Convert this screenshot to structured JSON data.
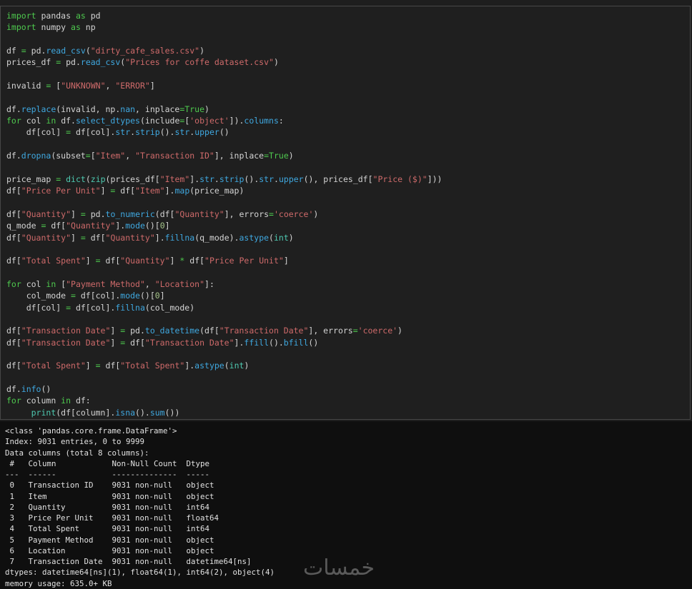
{
  "code_cell": {
    "lines": [
      [
        [
          "k",
          "import"
        ],
        [
          "p",
          " pandas "
        ],
        [
          "k",
          "as"
        ],
        [
          "p",
          " pd"
        ]
      ],
      [
        [
          "k",
          "import"
        ],
        [
          "p",
          " numpy "
        ],
        [
          "k",
          "as"
        ],
        [
          "p",
          " np"
        ]
      ],
      [],
      [
        [
          "p",
          "df "
        ],
        [
          "k",
          "="
        ],
        [
          "p",
          " pd."
        ],
        [
          "f",
          "read_csv"
        ],
        [
          "p",
          "("
        ],
        [
          "s",
          "\"dirty_cafe_sales.csv\""
        ],
        [
          "p",
          ")"
        ]
      ],
      [
        [
          "p",
          "prices_df "
        ],
        [
          "k",
          "="
        ],
        [
          "p",
          " pd."
        ],
        [
          "f",
          "read_csv"
        ],
        [
          "p",
          "("
        ],
        [
          "s",
          "\"Prices for coffe dataset.csv\""
        ],
        [
          "p",
          ")"
        ]
      ],
      [],
      [
        [
          "p",
          "invalid "
        ],
        [
          "k",
          "="
        ],
        [
          "p",
          " ["
        ],
        [
          "s",
          "\"UNKNOWN\""
        ],
        [
          "p",
          ", "
        ],
        [
          "s",
          "\"ERROR\""
        ],
        [
          "p",
          "]"
        ]
      ],
      [],
      [
        [
          "p",
          "df."
        ],
        [
          "f",
          "replace"
        ],
        [
          "p",
          "(invalid, np."
        ],
        [
          "f",
          "nan"
        ],
        [
          "p",
          ", inplace"
        ],
        [
          "k",
          "="
        ],
        [
          "k",
          "True"
        ],
        [
          "p",
          ")"
        ]
      ],
      [
        [
          "k",
          "for"
        ],
        [
          "p",
          " col "
        ],
        [
          "k",
          "in"
        ],
        [
          "p",
          " df."
        ],
        [
          "f",
          "select_dtypes"
        ],
        [
          "p",
          "(include"
        ],
        [
          "k",
          "="
        ],
        [
          "p",
          "["
        ],
        [
          "s",
          "'object'"
        ],
        [
          "p",
          "])."
        ],
        [
          "f",
          "columns"
        ],
        [
          "p",
          ":"
        ]
      ],
      [
        [
          "p",
          "    df[col] "
        ],
        [
          "k",
          "="
        ],
        [
          "p",
          " df[col]."
        ],
        [
          "f",
          "str"
        ],
        [
          "p",
          "."
        ],
        [
          "f",
          "strip"
        ],
        [
          "p",
          "()."
        ],
        [
          "f",
          "str"
        ],
        [
          "p",
          "."
        ],
        [
          "f",
          "upper"
        ],
        [
          "p",
          "()"
        ]
      ],
      [],
      [
        [
          "p",
          "df."
        ],
        [
          "f",
          "dropna"
        ],
        [
          "p",
          "(subset"
        ],
        [
          "k",
          "="
        ],
        [
          "p",
          "["
        ],
        [
          "s",
          "\"Item\""
        ],
        [
          "p",
          ", "
        ],
        [
          "s",
          "\"Transaction ID\""
        ],
        [
          "p",
          "], inplace"
        ],
        [
          "k",
          "="
        ],
        [
          "k",
          "True"
        ],
        [
          "p",
          ")"
        ]
      ],
      [],
      [
        [
          "p",
          "price_map "
        ],
        [
          "k",
          "="
        ],
        [
          "p",
          " "
        ],
        [
          "c",
          "dict"
        ],
        [
          "p",
          "("
        ],
        [
          "c",
          "zip"
        ],
        [
          "p",
          "(prices_df["
        ],
        [
          "s",
          "\"Item\""
        ],
        [
          "p",
          "]."
        ],
        [
          "f",
          "str"
        ],
        [
          "p",
          "."
        ],
        [
          "f",
          "strip"
        ],
        [
          "p",
          "()."
        ],
        [
          "f",
          "str"
        ],
        [
          "p",
          "."
        ],
        [
          "f",
          "upper"
        ],
        [
          "p",
          "(), prices_df["
        ],
        [
          "s",
          "\"Price ($)\""
        ],
        [
          "p",
          "]))"
        ]
      ],
      [
        [
          "p",
          "df["
        ],
        [
          "s",
          "\"Price Per Unit\""
        ],
        [
          "p",
          "] "
        ],
        [
          "k",
          "="
        ],
        [
          "p",
          " df["
        ],
        [
          "s",
          "\"Item\""
        ],
        [
          "p",
          "]."
        ],
        [
          "f",
          "map"
        ],
        [
          "p",
          "(price_map)"
        ]
      ],
      [],
      [
        [
          "p",
          "df["
        ],
        [
          "s",
          "\"Quantity\""
        ],
        [
          "p",
          "] "
        ],
        [
          "k",
          "="
        ],
        [
          "p",
          " pd."
        ],
        [
          "f",
          "to_numeric"
        ],
        [
          "p",
          "(df["
        ],
        [
          "s",
          "\"Quantity\""
        ],
        [
          "p",
          "], errors"
        ],
        [
          "k",
          "="
        ],
        [
          "s",
          "'coerce'"
        ],
        [
          "p",
          ")"
        ]
      ],
      [
        [
          "p",
          "q_mode "
        ],
        [
          "k",
          "="
        ],
        [
          "p",
          " df["
        ],
        [
          "s",
          "\"Quantity\""
        ],
        [
          "p",
          "]."
        ],
        [
          "f",
          "mode"
        ],
        [
          "p",
          "()["
        ],
        [
          "n",
          "0"
        ],
        [
          "p",
          "]"
        ]
      ],
      [
        [
          "p",
          "df["
        ],
        [
          "s",
          "\"Quantity\""
        ],
        [
          "p",
          "] "
        ],
        [
          "k",
          "="
        ],
        [
          "p",
          " df["
        ],
        [
          "s",
          "\"Quantity\""
        ],
        [
          "p",
          "]."
        ],
        [
          "f",
          "fillna"
        ],
        [
          "p",
          "(q_mode)."
        ],
        [
          "f",
          "astype"
        ],
        [
          "p",
          "("
        ],
        [
          "c",
          "int"
        ],
        [
          "p",
          ")"
        ]
      ],
      [],
      [
        [
          "p",
          "df["
        ],
        [
          "s",
          "\"Total Spent\""
        ],
        [
          "p",
          "] "
        ],
        [
          "k",
          "="
        ],
        [
          "p",
          " df["
        ],
        [
          "s",
          "\"Quantity\""
        ],
        [
          "p",
          "] "
        ],
        [
          "k",
          "*"
        ],
        [
          "p",
          " df["
        ],
        [
          "s",
          "\"Price Per Unit\""
        ],
        [
          "p",
          "]"
        ]
      ],
      [],
      [
        [
          "k",
          "for"
        ],
        [
          "p",
          " col "
        ],
        [
          "k",
          "in"
        ],
        [
          "p",
          " ["
        ],
        [
          "s",
          "\"Payment Method\""
        ],
        [
          "p",
          ", "
        ],
        [
          "s",
          "\"Location\""
        ],
        [
          "p",
          "]:"
        ]
      ],
      [
        [
          "p",
          "    col_mode "
        ],
        [
          "k",
          "="
        ],
        [
          "p",
          " df[col]."
        ],
        [
          "f",
          "mode"
        ],
        [
          "p",
          "()["
        ],
        [
          "n",
          "0"
        ],
        [
          "p",
          "]"
        ]
      ],
      [
        [
          "p",
          "    df[col] "
        ],
        [
          "k",
          "="
        ],
        [
          "p",
          " df[col]."
        ],
        [
          "f",
          "fillna"
        ],
        [
          "p",
          "(col_mode)"
        ]
      ],
      [],
      [
        [
          "p",
          "df["
        ],
        [
          "s",
          "\"Transaction Date\""
        ],
        [
          "p",
          "] "
        ],
        [
          "k",
          "="
        ],
        [
          "p",
          " pd."
        ],
        [
          "f",
          "to_datetime"
        ],
        [
          "p",
          "(df["
        ],
        [
          "s",
          "\"Transaction Date\""
        ],
        [
          "p",
          "], errors"
        ],
        [
          "k",
          "="
        ],
        [
          "s",
          "'coerce'"
        ],
        [
          "p",
          ")"
        ]
      ],
      [
        [
          "p",
          "df["
        ],
        [
          "s",
          "\"Transaction Date\""
        ],
        [
          "p",
          "] "
        ],
        [
          "k",
          "="
        ],
        [
          "p",
          " df["
        ],
        [
          "s",
          "\"Transaction Date\""
        ],
        [
          "p",
          "]."
        ],
        [
          "f",
          "ffill"
        ],
        [
          "p",
          "()."
        ],
        [
          "f",
          "bfill"
        ],
        [
          "p",
          "()"
        ]
      ],
      [],
      [
        [
          "p",
          "df["
        ],
        [
          "s",
          "\"Total Spent\""
        ],
        [
          "p",
          "] "
        ],
        [
          "k",
          "="
        ],
        [
          "p",
          " df["
        ],
        [
          "s",
          "\"Total Spent\""
        ],
        [
          "p",
          "]."
        ],
        [
          "f",
          "astype"
        ],
        [
          "p",
          "("
        ],
        [
          "c",
          "int"
        ],
        [
          "p",
          ")"
        ]
      ],
      [],
      [
        [
          "p",
          "df."
        ],
        [
          "f",
          "info"
        ],
        [
          "p",
          "()"
        ]
      ],
      [
        [
          "k",
          "for"
        ],
        [
          "p",
          " column "
        ],
        [
          "k",
          "in"
        ],
        [
          "p",
          " df:"
        ]
      ],
      [
        [
          "p",
          "     "
        ],
        [
          "c",
          "print"
        ],
        [
          "p",
          "(df[column]."
        ],
        [
          "f",
          "isna"
        ],
        [
          "p",
          "()."
        ],
        [
          "f",
          "sum"
        ],
        [
          "p",
          "())"
        ]
      ]
    ]
  },
  "output_cell": {
    "lines": [
      "<class 'pandas.core.frame.DataFrame'>",
      "Index: 9031 entries, 0 to 9999",
      "Data columns (total 8 columns):",
      " #   Column            Non-Null Count  Dtype",
      "---  ------            --------------  -----",
      " 0   Transaction ID    9031 non-null   object",
      " 1   Item              9031 non-null   object",
      " 2   Quantity          9031 non-null   int64",
      " 3   Price Per Unit    9031 non-null   float64",
      " 4   Total Spent       9031 non-null   int64",
      " 5   Payment Method    9031 non-null   object",
      " 6   Location          9031 non-null   object",
      " 7   Transaction Date  9031 non-null   datetime64[ns]",
      "dtypes: datetime64[ns](1), float64(1), int64(2), object(4)",
      "memory usage: 635.0+ KB"
    ]
  },
  "watermark": {
    "text": "خمسات"
  },
  "colors": {
    "keyword": "#4ec94e",
    "string": "#ce6a6a",
    "function": "#3fa8e0",
    "number": "#a5c48a",
    "builtin": "#4ec9b0",
    "text": "#d4d4d4"
  }
}
